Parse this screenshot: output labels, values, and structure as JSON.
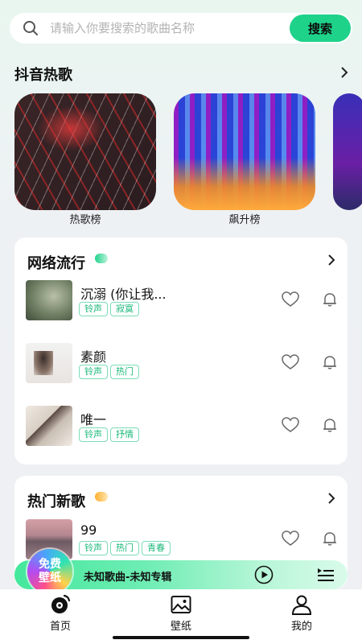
{
  "search": {
    "placeholder": "请输入你要搜索的歌曲名称",
    "button_label": "搜索"
  },
  "douyin": {
    "title": "抖音热歌",
    "charts": [
      {
        "label": "热歌榜"
      },
      {
        "label": "飙升榜"
      }
    ]
  },
  "network": {
    "title": "网络流行",
    "songs": [
      {
        "name": "沉溺 (你让我...",
        "tags": [
          "铃声",
          "寂寞"
        ]
      },
      {
        "name": "素颜",
        "tags": [
          "铃声",
          "热门"
        ]
      },
      {
        "name": "唯一",
        "tags": [
          "铃声",
          "抒情"
        ]
      }
    ]
  },
  "hot_new": {
    "title": "热门新歌",
    "songs": [
      {
        "name": "99",
        "tags": [
          "铃声",
          "热门",
          "青春"
        ]
      }
    ]
  },
  "player": {
    "badge_line1": "免费",
    "badge_line2": "壁纸",
    "now_playing": "未知歌曲-未知专辑"
  },
  "nav": [
    {
      "label": "首页"
    },
    {
      "label": "壁纸"
    },
    {
      "label": "我的"
    }
  ],
  "colors": {
    "accent": "#1ed28a",
    "tag_text": "#19b979",
    "tag_border": "#7cdcb6"
  }
}
